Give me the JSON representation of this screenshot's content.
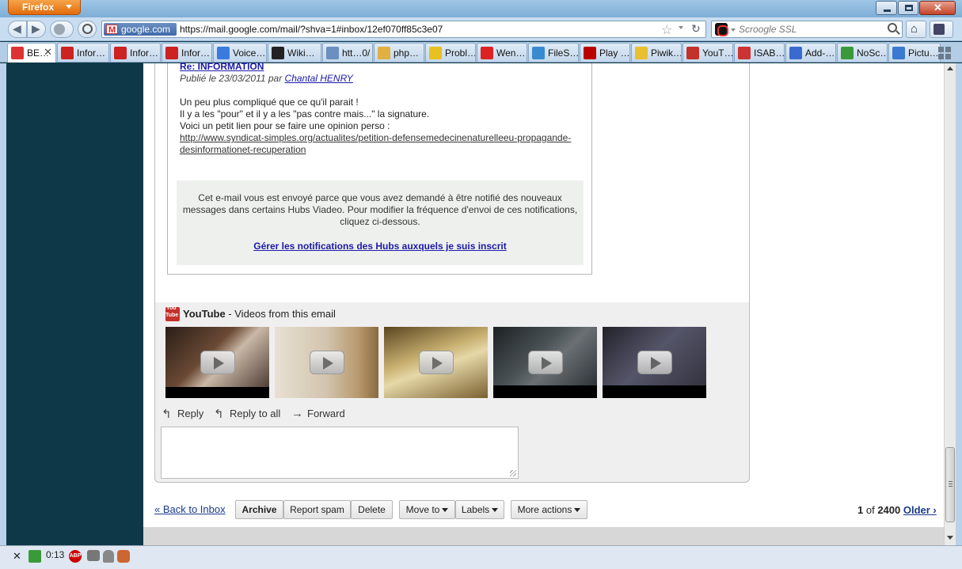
{
  "browser": {
    "menu_button": "Firefox",
    "window_controls": {
      "minimize_icon": "minimize-icon",
      "maximize_icon": "maximize-icon",
      "close_icon": "close-icon"
    }
  },
  "navbar": {
    "identity_label": "google.com",
    "url": "https://mail.google.com/mail/?shva=1#inbox/12ef070ff85c3e07",
    "search_placeholder": "Scroogle SSL"
  },
  "tabs": [
    {
      "label": "BE…",
      "icon": "gmail-icon",
      "color": "#d33"
    },
    {
      "label": "Infor…",
      "icon": "ja-icon",
      "color": "#c22"
    },
    {
      "label": "Infor…",
      "icon": "ja-icon",
      "color": "#c22"
    },
    {
      "label": "Infor…",
      "icon": "ja-icon",
      "color": "#c22"
    },
    {
      "label": "Voice…",
      "icon": "google-icon",
      "color": "#3a7be0"
    },
    {
      "label": "Wiki…",
      "icon": "wiki-icon",
      "color": "#222"
    },
    {
      "label": "htt…0/",
      "icon": "gear-icon",
      "color": "#6a8fc0"
    },
    {
      "label": "php…",
      "icon": "pma-icon",
      "color": "#e0b040"
    },
    {
      "label": "Probl…",
      "icon": "warning-icon",
      "color": "#e8c020"
    },
    {
      "label": "Wen…",
      "icon": "wen-icon",
      "color": "#d22"
    },
    {
      "label": "FileS…",
      "icon": "files-icon",
      "color": "#3a8ad0"
    },
    {
      "label": "Play …",
      "icon": "k-icon",
      "color": "#b00"
    },
    {
      "label": "Piwik…",
      "icon": "piwik-icon",
      "color": "#e8c030"
    },
    {
      "label": "YouT…",
      "icon": "youtube-icon",
      "color": "#c4302b"
    },
    {
      "label": "ISAB…",
      "icon": "isab-icon",
      "color": "#c33"
    },
    {
      "label": "Add-…",
      "icon": "puzzle-icon",
      "color": "#3a6ad0"
    },
    {
      "label": "NoSc…",
      "icon": "noscript-icon",
      "color": "#3a9a3a"
    },
    {
      "label": "Pictu…",
      "icon": "picture-icon",
      "color": "#3a7ad0"
    }
  ],
  "email": {
    "post_title": "Re: INFORMATION",
    "post_meta_prefix": "Publié le 23/03/2011 par ",
    "post_author": "Chantal HENRY",
    "body_lines": [
      "Un peu plus compliqué que ce qu'il parait !",
      "Il y a les \"pour\" et il y a les \"pas contre mais...\" la signature.",
      "Voici un petit lien pour se faire une opinion perso :"
    ],
    "link_text": "http://www.syndicat-simples.org/actualites/petition-defensemedecinenaturelleeu-propagande-desinformationet-recuperation",
    "notification_text": "Cet e-mail vous est envoyé parce que vous avez demandé à être notifié des nouveaux messages dans certains Hubs Viadeo. Pour modifier la fréquence d'envoi de ces notifications, cliquez ci-dessous.",
    "notification_link": "Gérer les notifications des Hubs auxquels je suis inscrit"
  },
  "youtube": {
    "brand": "YouTube",
    "subtitle": " - Videos from this email",
    "thumbnails": [
      {
        "icon": "play-icon",
        "bg": "#3a2a22"
      },
      {
        "icon": "play-icon",
        "bg": "#d8cbb8"
      },
      {
        "icon": "play-icon",
        "bg": "#a08850"
      },
      {
        "icon": "play-icon",
        "bg": "#2a2e30"
      },
      {
        "icon": "play-icon",
        "bg": "#3a3a44"
      }
    ]
  },
  "actions": {
    "reply": "Reply",
    "reply_all": "Reply to all",
    "forward": "Forward"
  },
  "toolbar": {
    "back_to_inbox": "« Back to Inbox",
    "archive": "Archive",
    "report_spam": "Report spam",
    "delete": "Delete",
    "move_to": "Move to",
    "labels": "Labels",
    "more_actions": "More actions",
    "page_current": "1",
    "page_of": " of ",
    "page_total": "2400",
    "older": "Older ›"
  },
  "statusbar": {
    "timer": "0:13",
    "abp": "ABP"
  },
  "colors": {
    "page_background": "#0e3847",
    "link_blue": "#1a1aa6",
    "chrome_blue": "#c9ddf1"
  }
}
